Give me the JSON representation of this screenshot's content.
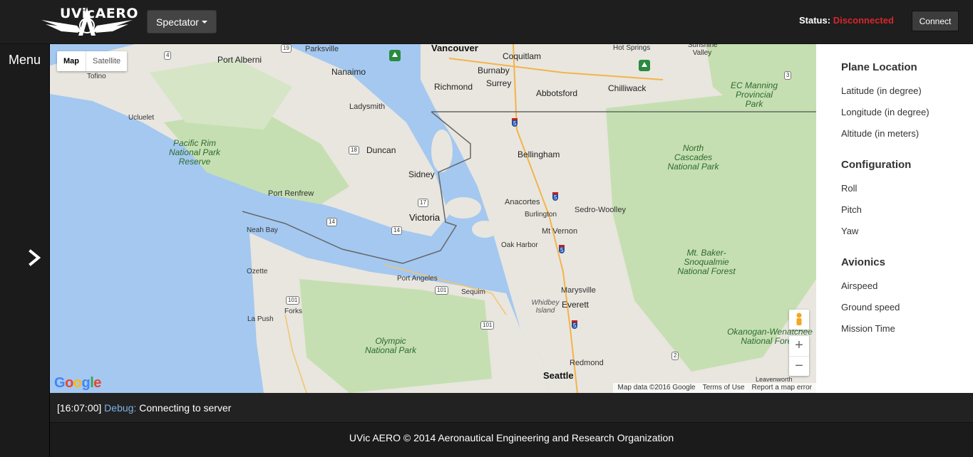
{
  "header": {
    "logo_text": "UVicAERO",
    "mode_button": "Spectator",
    "status_label": "Status:",
    "status_value": "Disconnected",
    "connect_button": "Connect",
    "colors": {
      "status_error": "#d9262c",
      "bar": "#1e1e1e"
    }
  },
  "sidebar": {
    "title": "Menu",
    "toggle_icon": "chevron-right-icon"
  },
  "map": {
    "type_controls": [
      "Map",
      "Satellite"
    ],
    "active_type": "Map",
    "google_logo": "Google",
    "attribution": [
      "Map data ©2016 Google",
      "Terms of Use",
      "Report a map error"
    ],
    "zoom_in": "+",
    "zoom_out": "−",
    "labels": {
      "parksville": "Parksville",
      "vancouver": "Vancouver",
      "coquitlam": "Coquitlam",
      "port_alberni": "Port Alberni",
      "nanaimo": "Nanaimo",
      "burnaby": "Burnaby",
      "surrey": "Surrey",
      "richmond": "Richmond",
      "abbotsford": "Abbotsford",
      "chilliwack": "Chilliwack",
      "hot_springs": "Hot Springs",
      "sunshine_valley": "Sunshine Valley",
      "tofino": "Tofino",
      "ucluelet": "Ucluelet",
      "ladysmith": "Ladysmith",
      "duncan": "Duncan",
      "sidney": "Sidney",
      "bellingham": "Bellingham",
      "port_renfrew": "Port Renfrew",
      "victoria": "Victoria",
      "anacortes": "Anacortes",
      "burlington": "Burlington",
      "sedro_woolley": "Sedro-Woolley",
      "mt_vernon": "Mt Vernon",
      "neah_bay": "Neah Bay",
      "oak_harbor": "Oak Harbor",
      "ozette": "Ozette",
      "port_angeles": "Port Angeles",
      "sequim": "Sequim",
      "marysville": "Marysville",
      "everett": "Everett",
      "forks": "Forks",
      "la_push": "La Push",
      "redmond": "Redmond",
      "seattle": "Seattle",
      "leavenworth": "Leavenworth",
      "pacific_rim": "Pacific Rim National Park Reserve",
      "ec_manning": "EC Manning Provincial Park",
      "north_cascades": "North Cascades National Park",
      "baker_snoqualmie": "Mt. Baker-Snoqualmie National Forest",
      "olympic": "Olympic National Park",
      "okanogan": "Okanogan-Wenatchee National Forest",
      "whidbey": "Whidbey Island"
    },
    "shields": [
      "19",
      "4",
      "18",
      "17",
      "14",
      "14",
      "101",
      "101",
      "101",
      "5",
      "5",
      "5",
      "5",
      "2",
      "3"
    ]
  },
  "panel": {
    "sections": [
      {
        "title": "Plane Location",
        "items": [
          "Latitude (in degree)",
          "Longitude (in degree)",
          "Altitude (in meters)"
        ]
      },
      {
        "title": "Configuration",
        "items": [
          "Roll",
          "Pitch",
          "Yaw"
        ]
      },
      {
        "title": "Avionics",
        "items": [
          "Airspeed",
          "Ground speed",
          "Mission Time"
        ]
      }
    ]
  },
  "console": {
    "time": "[16:07:00]",
    "level": "Debug:",
    "message": "Connecting to server"
  },
  "footer": {
    "text": "UVic AERO © 2014 Aeronautical Engineering and Research Organization"
  }
}
